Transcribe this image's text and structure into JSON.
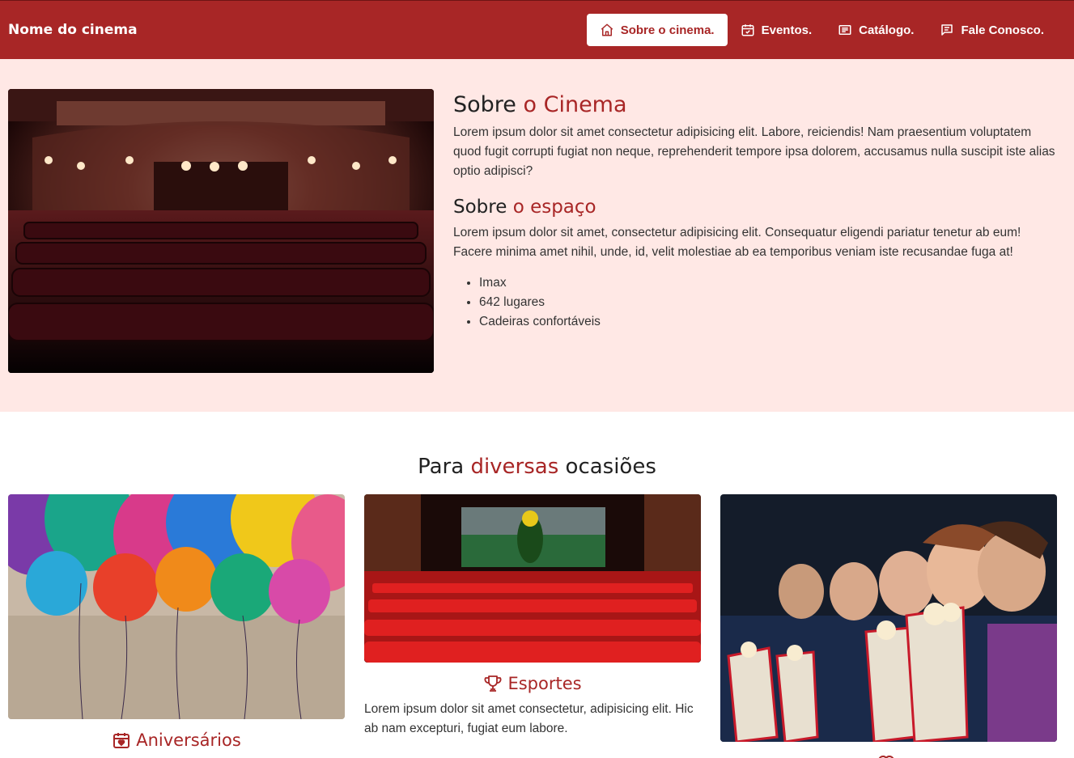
{
  "navbar": {
    "brand": "Nome do cinema",
    "items": [
      {
        "label": "Sobre o cinema.",
        "icon": "home-icon",
        "active": true
      },
      {
        "label": "Eventos.",
        "icon": "calendar-check-icon",
        "active": false
      },
      {
        "label": "Catálogo.",
        "icon": "list-icon",
        "active": false
      },
      {
        "label": "Fale Conosco.",
        "icon": "message-icon",
        "active": false
      }
    ]
  },
  "about": {
    "title_part1": "Sobre ",
    "title_part2": "o Cinema",
    "paragraph": "Lorem ipsum dolor sit amet consectetur adipisicing elit. Labore, reiciendis! Nam praesentium voluptatem quod fugit corrupti fugiat non neque, reprehenderit tempore ipsa dolorem, accusamus nulla suscipit iste alias optio adipisci?",
    "space_title_part1": "Sobre ",
    "space_title_part2": "o espaço",
    "space_paragraph": "Lorem ipsum dolor sit amet, consectetur adipisicing elit. Consequatur eligendi pariatur tenetur ab eum! Facere minima amet nihil, unde, id, velit molestiae ab ea temporibus veniam iste recusandae fuga at!",
    "features": [
      "Imax",
      "642 lugares",
      "Cadeiras confortáveis"
    ]
  },
  "occasions": {
    "title_part1": "Para ",
    "title_part2": "diversas",
    "title_part3": " ocasiões",
    "cards": [
      {
        "title": "Aniversários",
        "icon": "calendar-heart-icon",
        "image": "balloons-photo"
      },
      {
        "title": "Esportes",
        "icon": "trophy-icon",
        "image": "stadium-cinema-photo",
        "description": "Lorem ipsum dolor sit amet consectetur, adipisicing elit. Hic ab nam excepturi, fugiat eum labore."
      },
      {
        "title": "",
        "icon": "heart-icon",
        "image": "kids-popcorn-photo"
      }
    ]
  },
  "colors": {
    "primary": "#a82626",
    "about_bg": "#ffe8e5"
  }
}
